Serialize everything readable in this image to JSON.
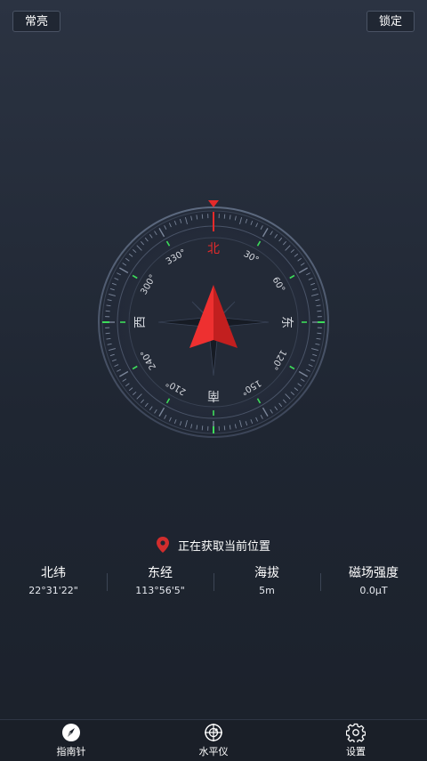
{
  "header": {
    "left_button": "常亮",
    "right_button": "锁定"
  },
  "compass": {
    "directions": {
      "north": "北",
      "east": "东",
      "south": "南",
      "west": "西"
    },
    "degree_labels": [
      "30°",
      "60°",
      "120°",
      "150°",
      "210°",
      "240°",
      "300°",
      "330°"
    ],
    "heading_deg": 0,
    "colors": {
      "north_needle": "#e52a2a",
      "marker": "#e52a2a",
      "accent_tick": "#3ddc5a",
      "label": "#d6d9df"
    }
  },
  "location": {
    "status": "正在获取当前位置",
    "pin_color": "#d12d2d"
  },
  "info": [
    {
      "label": "北纬",
      "value": "22°31'22\""
    },
    {
      "label": "东经",
      "value": "113°56'5\""
    },
    {
      "label": "海拔",
      "value": "5m"
    },
    {
      "label": "磁场强度",
      "value": "0.0μT"
    }
  ],
  "tabs": [
    {
      "label": "指南针",
      "icon": "compass-icon",
      "active": true
    },
    {
      "label": "水平仪",
      "icon": "level-icon",
      "active": false
    },
    {
      "label": "设置",
      "icon": "gear-icon",
      "active": false
    }
  ]
}
